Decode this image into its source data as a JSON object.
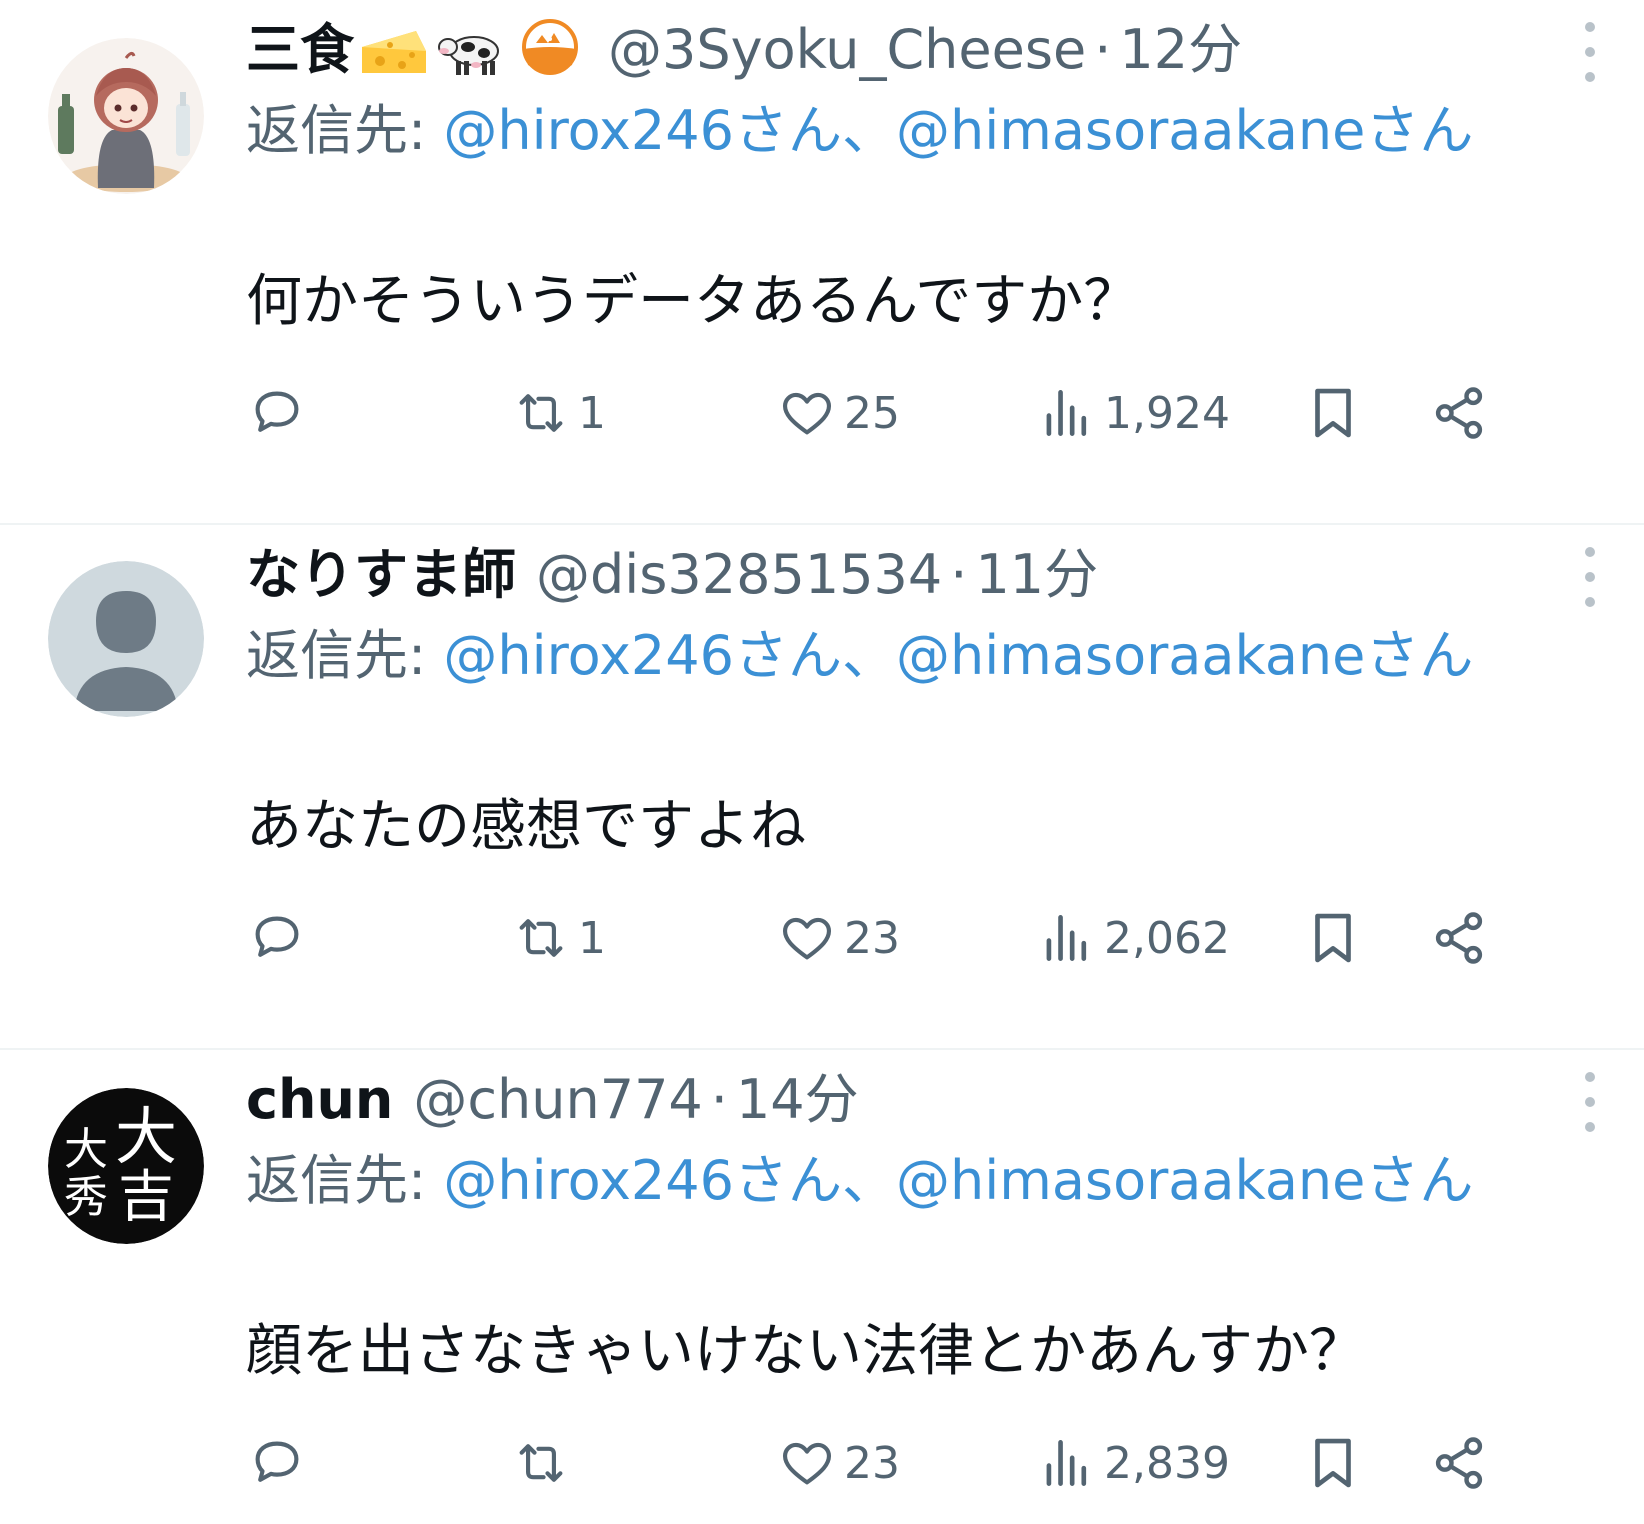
{
  "tweets": [
    {
      "display_name": "三食",
      "emojis": [
        "cheese-emoji",
        "cow-emoji",
        "rice-bowl-emoji"
      ],
      "handle": "@3Syoku_Cheese",
      "separator": "·",
      "time": "12分",
      "reply_prefix": "返信先: ",
      "mention_1": "@hirox246さん",
      "mention_sep": "、",
      "mention_2": "@himasoraakaneさん",
      "text": "何かそういうデータあるんですか？",
      "retweets": "1",
      "likes": "25",
      "views": "1,924",
      "avatar": "anime-girl-avatar"
    },
    {
      "display_name": "なりすま師",
      "emojis": [],
      "handle": "@dis32851534",
      "separator": "·",
      "time": "11分",
      "reply_prefix": "返信先: ",
      "mention_1": "@hirox246さん",
      "mention_sep": "、",
      "mention_2": "@himasoraakaneさん",
      "text": "あなたの感想ですよね",
      "retweets": "1",
      "likes": "23",
      "views": "2,062",
      "avatar": "default-avatar"
    },
    {
      "display_name": "chun",
      "emojis": [],
      "handle": "@chun774",
      "separator": "·",
      "time": "14分",
      "reply_prefix": "返信先: ",
      "mention_1": "@hirox246さん",
      "mention_sep": "、",
      "mention_2": "@himasoraakaneさん",
      "text": "顔を出さなきゃいけない法律とかあんすか？",
      "retweets": "",
      "likes": "23",
      "views": "2,839",
      "avatar": "kanji-logo-avatar",
      "avatar_glyphs": [
        "大",
        "大",
        "秀",
        "吉"
      ]
    }
  ],
  "colors": {
    "mention": "#3b90d5",
    "secondary_text": "#536471",
    "divider": "#eff3f4"
  }
}
